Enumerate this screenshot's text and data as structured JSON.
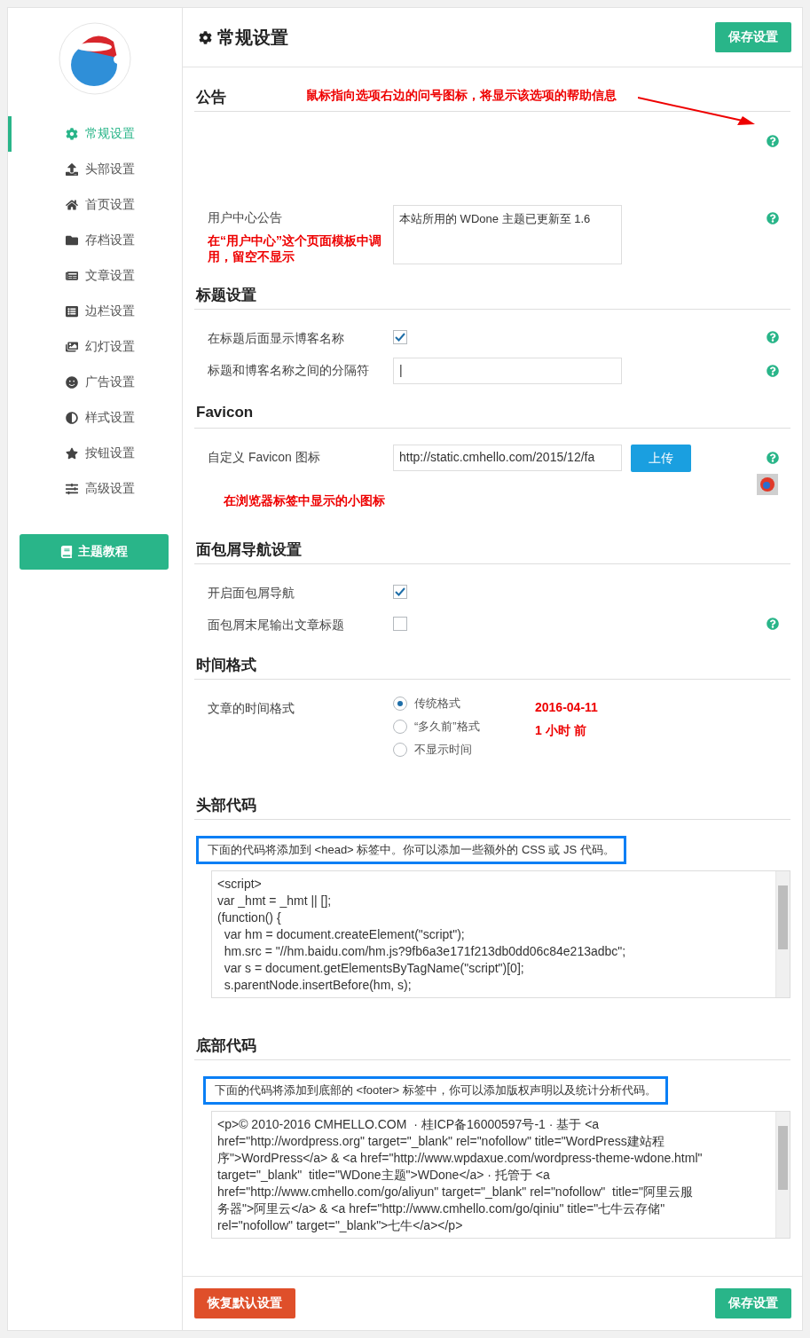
{
  "sidebar": {
    "items": [
      {
        "label": "常规设置",
        "selected": true
      },
      {
        "label": "头部设置",
        "selected": false
      },
      {
        "label": "首页设置",
        "selected": false
      },
      {
        "label": "存档设置",
        "selected": false
      },
      {
        "label": "文章设置",
        "selected": false
      },
      {
        "label": "边栏设置",
        "selected": false
      },
      {
        "label": "幻灯设置",
        "selected": false
      },
      {
        "label": "广告设置",
        "selected": false
      },
      {
        "label": "样式设置",
        "selected": false
      },
      {
        "label": "按钮设置",
        "selected": false
      },
      {
        "label": "高级设置",
        "selected": false
      }
    ],
    "guide_button": "主题教程"
  },
  "header": {
    "title": "常规设置",
    "save_button": "保存设置"
  },
  "sections": [
    {
      "title": "公告",
      "note": "鼠标指向选项右边的问号图标，将显示该选项的帮助信息",
      "rows": [
        {
          "kind": "blank",
          "help": true
        },
        {
          "kind": "textarea",
          "label": "用户中心公告",
          "note": "在“用户中心”这个页面模板中调用，留空不显示",
          "value": "本站所用的 WDone 主题已更新至 1.6",
          "help": true
        }
      ]
    },
    {
      "title": "标题设置",
      "rows": [
        {
          "kind": "checkbox",
          "label": "在标题后面显示博客名称",
          "checked": true,
          "help": true
        },
        {
          "kind": "text",
          "label": "标题和博客名称之间的分隔符",
          "value": "|",
          "help": true
        }
      ]
    },
    {
      "title": "Favicon",
      "rows": [
        {
          "kind": "upload",
          "label": "自定义 Favicon 图标",
          "value": "http://static.cmhello.com/2015/12/fa",
          "button": "上传",
          "note": "在浏览器标签中显示的小图标",
          "help": true
        }
      ]
    },
    {
      "title": "面包屑导航设置",
      "rows": [
        {
          "kind": "checkbox",
          "label": "开启面包屑导航",
          "checked": true,
          "help": false
        },
        {
          "kind": "checkbox",
          "label": "面包屑末尾输出文章标题",
          "checked": false,
          "help": true
        }
      ]
    },
    {
      "title": "时间格式",
      "rows": [
        {
          "kind": "radio",
          "label": "文章的时间格式",
          "options": [
            {
              "label": "传统格式",
              "selected": true
            },
            {
              "label": "“多久前”格式",
              "selected": false
            },
            {
              "label": "不显示时间",
              "selected": false
            }
          ],
          "examples": [
            "2016-04-11",
            "1 小时 前"
          ],
          "help": false
        }
      ]
    },
    {
      "title": "头部代码",
      "rows": [
        {
          "kind": "code",
          "description": "下面的代码将添加到 <head> 标签中。你可以添加一些额外的 CSS 或 JS 代码。",
          "lines": [
            "<script>",
            "var _hmt = _hmt || [];",
            "(function() {",
            "  var hm = document.createElement(\"script\");",
            "  hm.src = \"//hm.baidu.com/hm.js?9fb6a3e171f213db0dd06c84e213adbc\";",
            "  var s = document.getElementsByTagName(\"script\")[0];",
            "  s.parentNode.insertBefore(hm, s);"
          ]
        }
      ]
    },
    {
      "title": "底部代码",
      "rows": [
        {
          "kind": "code",
          "description": "下面的代码将添加到底部的 <footer> 标签中，你可以添加版权声明以及统计分析代码。",
          "lines": [
            "<p>© 2010-2016 CMHELLO.COM  · 桂ICP备16000597号-1 · 基于 <a",
            "href=\"http://wordpress.org\" target=\"_blank\" rel=\"nofollow\" title=\"WordPress建站程",
            "序\">WordPress</a> & <a href=\"http://www.wpdaxue.com/wordpress-theme-wdone.html\"",
            "target=\"_blank\"  title=\"WDone主题\">WDone</a> · 托管于 <a",
            "href=\"http://www.cmhello.com/go/aliyun\" target=\"_blank\" rel=\"nofollow\"  title=\"阿里云服",
            "务器\">阿里云</a> & <a href=\"http://www.cmhello.com/go/qiniu\" title=\"七牛云存储\"",
            "rel=\"nofollow\" target=\"_blank\">七牛</a></p>"
          ]
        }
      ]
    }
  ],
  "footer": {
    "reset_button": "恢复默认设置",
    "save_button": "保存设置"
  }
}
